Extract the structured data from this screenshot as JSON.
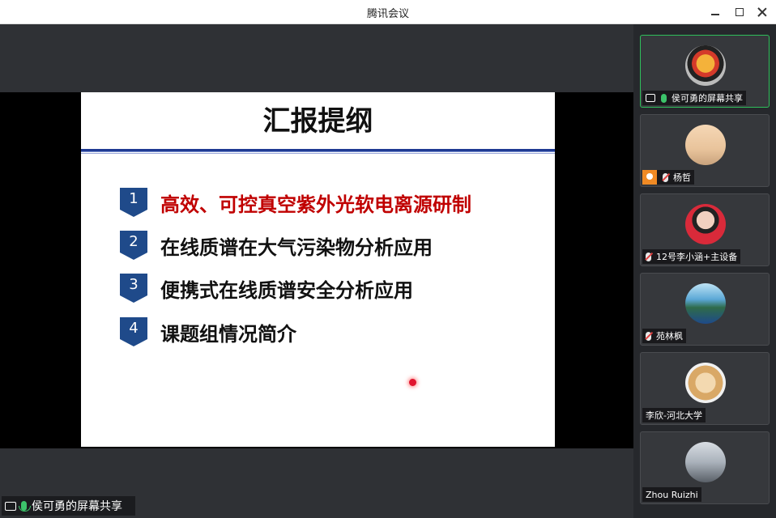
{
  "window": {
    "title": "腾讯会议"
  },
  "slide": {
    "title": "汇报提纲",
    "items": [
      {
        "num": "1",
        "text": "高效、可控真空紫外光软电离源研制"
      },
      {
        "num": "2",
        "text": "在线质谱在大气污染物分析应用"
      },
      {
        "num": "3",
        "text": "便携式在线质谱安全分析应用"
      },
      {
        "num": "4",
        "text": "课题组情况简介"
      }
    ]
  },
  "share_label": "侯可勇的屏幕共享",
  "participants": [
    {
      "name": "侯可勇的屏幕共享"
    },
    {
      "name": "杨哲"
    },
    {
      "name": "12号李小涵+主设备"
    },
    {
      "name": "苑林枫"
    },
    {
      "name": "李欣-河北大学"
    },
    {
      "name": "Zhou Ruizhi"
    }
  ]
}
